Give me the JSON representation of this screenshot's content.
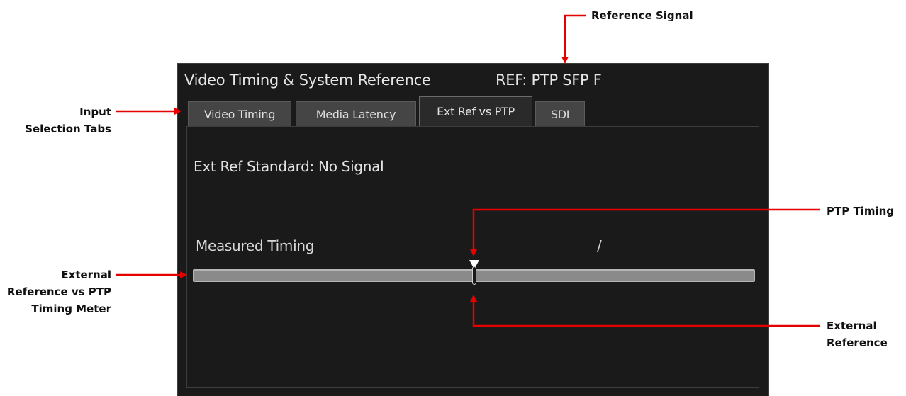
{
  "callouts": {
    "reference_signal": "Reference Signal",
    "input_tabs_line1": "Input",
    "input_tabs_line2": "Selection Tabs",
    "ptp_timing": "PTP Timing",
    "meter_line1": "External",
    "meter_line2": "Reference vs PTP",
    "meter_line3": "Timing Meter",
    "ext_ref_line1": "External",
    "ext_ref_line2": "Reference"
  },
  "panel": {
    "title": "Video Timing & System Reference",
    "ref": "REF: PTP SFP F",
    "tabs": [
      {
        "label": "Video Timing",
        "active": false
      },
      {
        "label": "Media Latency",
        "active": false
      },
      {
        "label": "Ext Ref vs PTP",
        "active": true
      },
      {
        "label": "SDI",
        "active": false
      }
    ],
    "ext_ref_standard": "Ext Ref Standard: No Signal",
    "measured_label": "Measured Timing",
    "measured_value": "/",
    "meter": {
      "ext_ref_position": 0.5,
      "ptp_position": 0.5
    }
  },
  "colors": {
    "panel_bg": "#1a1a1a",
    "text": "#e6e6e6",
    "arrow": "#e60000",
    "meter_fill": "#8a8a8a"
  }
}
